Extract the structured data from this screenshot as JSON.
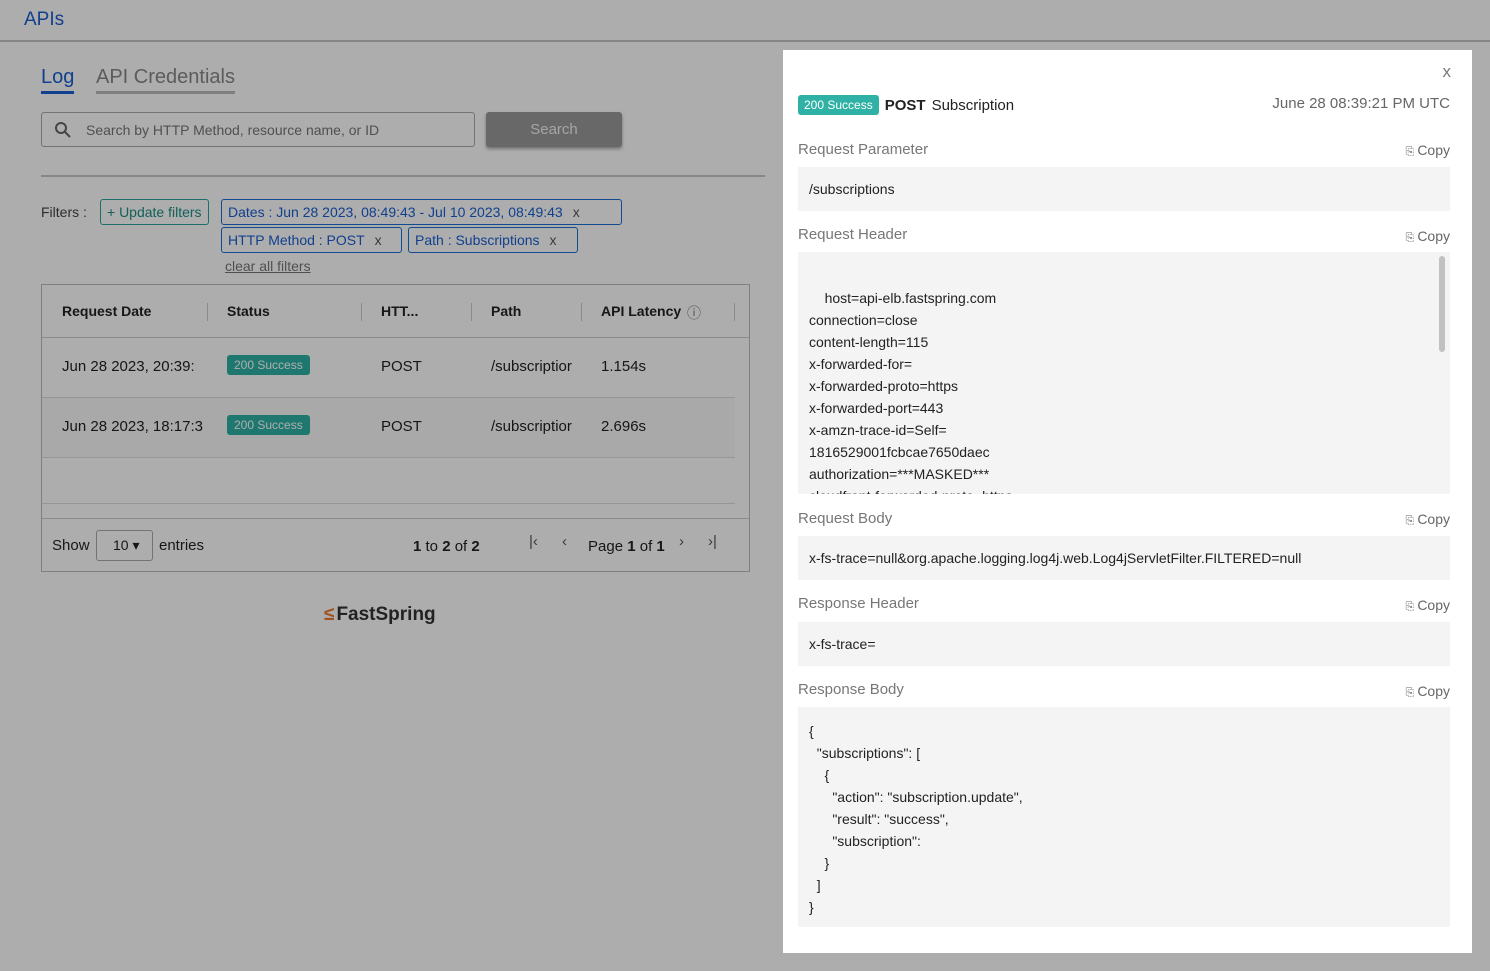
{
  "app": {
    "title": "APIs"
  },
  "tabs": [
    {
      "label": "Log",
      "active": true
    },
    {
      "label": "API Credentials",
      "active": false
    }
  ],
  "search": {
    "placeholder": "Search by HTTP Method, resource name, or ID",
    "value": "",
    "button_label": "Search"
  },
  "filters": {
    "label": "Filters :",
    "update_label": "+ Update filters",
    "chips": [
      {
        "label": "Dates : Jun 28 2023, 08:49:43 - Jul 10 2023, 08:49:43"
      },
      {
        "label": "HTTP Method : POST"
      },
      {
        "label": "Path : Subscriptions"
      }
    ],
    "remove_glyph": "x",
    "clear_label": "clear all filters"
  },
  "table": {
    "headers": [
      "Request Date",
      "Status",
      "HTT...",
      "Path",
      "API Latency"
    ],
    "info_glyph": "ⓘ",
    "rows": [
      {
        "date": "Jun 28 2023, 20:39:",
        "status": "200 Success",
        "method": "POST",
        "path": "/subscriptior",
        "latency": "1.154s"
      },
      {
        "date": "Jun 28 2023, 18:17:3",
        "status": "200 Success",
        "method": "POST",
        "path": "/subscriptior",
        "latency": "2.696s"
      }
    ],
    "footer": {
      "show_label": "Show",
      "entries_value": "10",
      "entries_label": "entries",
      "range_from": "1",
      "range_to_word": "to",
      "range_to": "2",
      "range_of_word": "of",
      "range_total": "2",
      "page_word": "Page",
      "page_current": "1",
      "page_of_word": "of",
      "page_total": "1"
    }
  },
  "brand": {
    "logo_text": "FastSpring",
    "logo_mark": "≤"
  },
  "detail": {
    "close_glyph": "x",
    "status_badge": "200 Success",
    "method": "POST",
    "resource": "Subscription",
    "timestamp": "June 28 08:39:21 PM UTC",
    "copy_label": "Copy",
    "sections": {
      "request_parameter": {
        "title": "Request Parameter",
        "body": "/subscriptions"
      },
      "request_header": {
        "title": "Request Header",
        "body": "host=api-elb.fastspring.com\nconnection=close\ncontent-length=115\nx-forwarded-for=\nx-forwarded-proto=https\nx-forwarded-port=443\nx-amzn-trace-id=Self=\n1816529001fcbcae7650daec\nauthorization=***MASKED***\ncloudfront-forwarded-proto=https\ncloudfront-is-desktop-viewer=true"
      },
      "request_body": {
        "title": "Request Body",
        "body": "x-fs-trace=null&org.apache.logging.log4j.web.Log4jServletFilter.FILTERED=null"
      },
      "response_header": {
        "title": "Response Header",
        "body": "x-fs-trace="
      },
      "response_body": {
        "title": "Response Body",
        "body": "{\n  \"subscriptions\": [\n    {\n      \"action\": \"subscription.update\",\n      \"result\": \"success\",\n      \"subscription\": \n    }\n  ]\n}"
      }
    }
  },
  "colors": {
    "accent": "#1a5fd1",
    "success": "#2fb1a5",
    "overlay": "rgba(0,0,0,0.32)"
  }
}
